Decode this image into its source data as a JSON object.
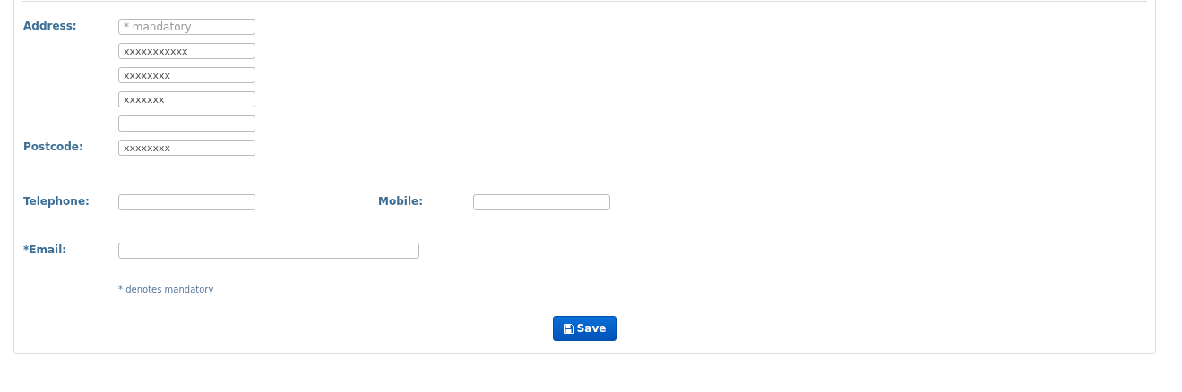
{
  "address": {
    "label": "Address:",
    "lines": [
      {
        "kind": "field",
        "placeholder": "* mandatory"
      },
      {
        "kind": "field",
        "value": "xxxxxxxxxxx"
      },
      {
        "kind": "field",
        "value": "xxxxxxxx"
      },
      {
        "kind": "field",
        "value": "xxxxxxx"
      },
      {
        "kind": "field"
      }
    ]
  },
  "postcode": {
    "label": "Postcode:",
    "value": "xxxxxxxx"
  },
  "telephone": {
    "label": "Telephone:"
  },
  "mobile": {
    "label": "Mobile:"
  },
  "email": {
    "label": "*Email:"
  },
  "note": "* denotes mandatory",
  "save_button": {
    "label": "Save"
  }
}
